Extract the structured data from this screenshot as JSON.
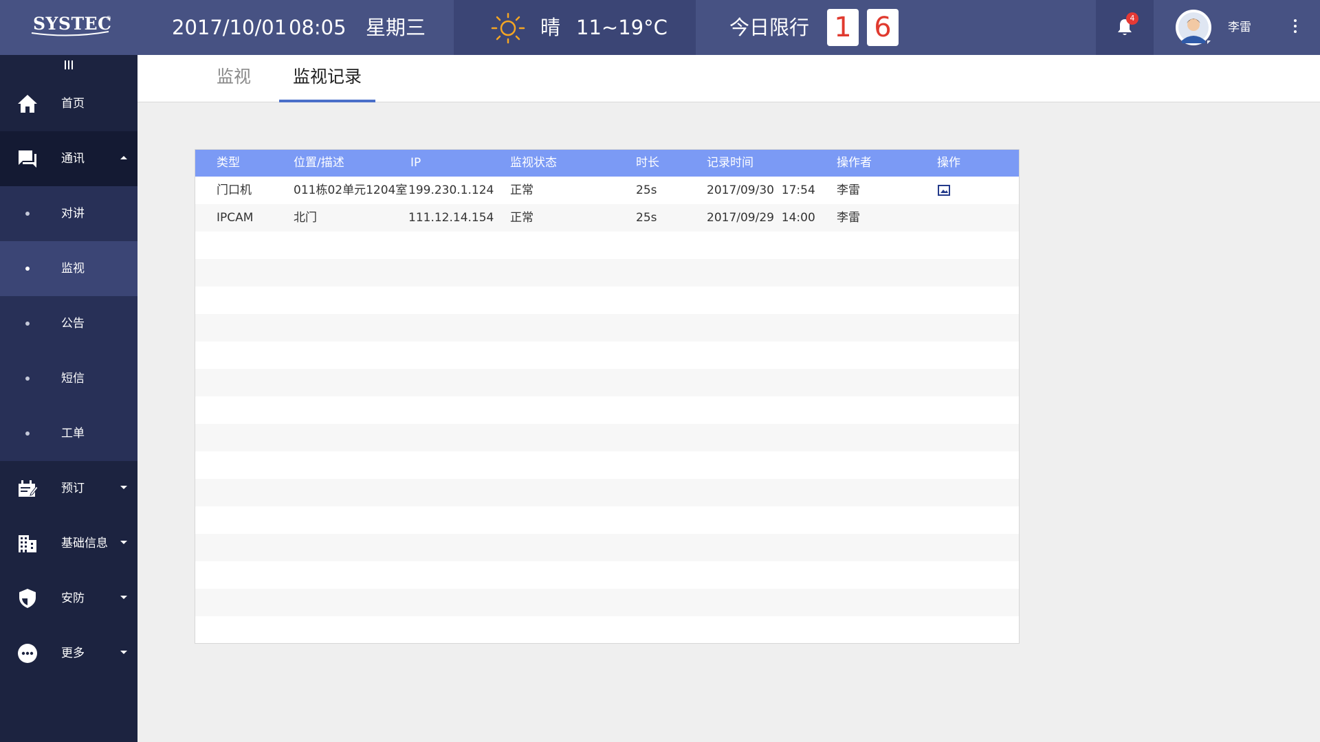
{
  "app": {
    "logo_text": "SYSTEC",
    "logo_reg": "®"
  },
  "header": {
    "date": "2017/10/01",
    "time": "08:05",
    "weekday": "星期三",
    "weather": {
      "icon": "sun-icon",
      "condition": "晴",
      "temperature": "11~19°C"
    },
    "traffic_limit": {
      "label": "今日限行",
      "digits": [
        "1",
        "6"
      ]
    },
    "notifications": {
      "icon": "bell-icon",
      "count": "4"
    },
    "user": {
      "name": "李雷",
      "avatar": "avatar-icon"
    },
    "more_icon": "more-vertical-icon"
  },
  "sidebar": {
    "collapse_icon": "collapse-icon",
    "items": [
      {
        "id": "home",
        "label": "首页",
        "icon": "home-icon"
      },
      {
        "id": "tongxun",
        "label": "通讯",
        "icon": "chat-icon",
        "expanded": true
      },
      {
        "id": "duijiang",
        "label": "对讲",
        "sub": true
      },
      {
        "id": "jianshi",
        "label": "监视",
        "sub": true,
        "active": true
      },
      {
        "id": "gonggao",
        "label": "公告",
        "sub": true
      },
      {
        "id": "duanxin",
        "label": "短信",
        "sub": true
      },
      {
        "id": "gongdan",
        "label": "工单",
        "sub": true
      },
      {
        "id": "yuding",
        "label": "预订",
        "icon": "booking-icon"
      },
      {
        "id": "jichu",
        "label": "基础信息",
        "icon": "building-icon"
      },
      {
        "id": "anfang",
        "label": "安防",
        "icon": "shield-icon"
      },
      {
        "id": "gengduo",
        "label": "更多",
        "icon": "more-icon"
      }
    ]
  },
  "tabs": [
    {
      "label": "监视",
      "active": false
    },
    {
      "label": "监视记录",
      "active": true
    }
  ],
  "table": {
    "columns": [
      "类型",
      "位置/描述",
      "IP",
      "监视状态",
      "时长",
      "记录时间",
      "操作者",
      "操作"
    ],
    "rows": [
      {
        "type": "门口机",
        "location": "011栋02单元1204室",
        "ip": "199.230.1.124",
        "status": "正常",
        "duration": "25s",
        "time": "2017/09/30  17:54",
        "operator": "李雷",
        "action_icon": "image-icon"
      },
      {
        "type": "IPCAM",
        "location": "北门",
        "ip": "111.12.14.154",
        "status": "正常",
        "duration": "25s",
        "time": "2017/09/29  14:00",
        "operator": "李雷"
      }
    ]
  },
  "colors": {
    "header_bg": "#475283",
    "sidebar_bg": "#1c2340",
    "table_header_bg": "#7b9af5",
    "tab_underline": "#4a6fc9",
    "plate_digit": "#e03a2f",
    "sun": "#f5a623"
  }
}
